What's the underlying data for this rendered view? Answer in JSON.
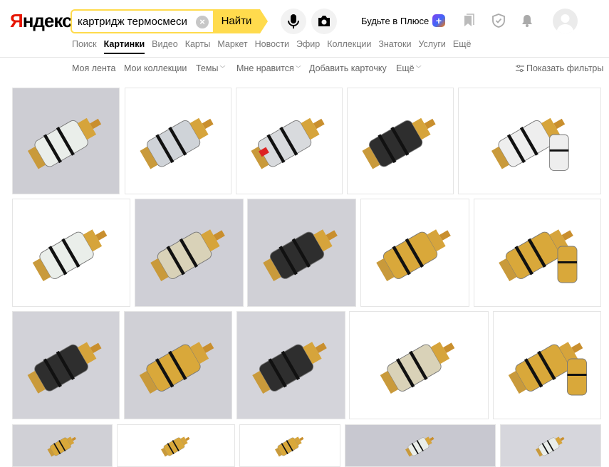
{
  "logo": {
    "first_letter": "Я",
    "rest": "ндекс"
  },
  "search": {
    "value": "картридж термосмеси",
    "button_label": "Найти"
  },
  "header": {
    "plus_label": "Будьте в Плюсе",
    "plus_badge": "+"
  },
  "services": [
    {
      "label": "Поиск"
    },
    {
      "label": "Картинки",
      "active": true
    },
    {
      "label": "Видео"
    },
    {
      "label": "Карты"
    },
    {
      "label": "Маркет"
    },
    {
      "label": "Новости"
    },
    {
      "label": "Эфир"
    },
    {
      "label": "Коллекции"
    },
    {
      "label": "Знатоки"
    },
    {
      "label": "Услуги"
    },
    {
      "label": "Ещё"
    }
  ],
  "subnav": {
    "feed": "Моя лента",
    "collections": "Мои коллекции",
    "themes": "Темы",
    "liked": "Мне нравится",
    "add_card": "Добавить карточку",
    "more": "Ещё",
    "filters": "Показать фильтры"
  },
  "images": [
    {
      "bg": "#cdcdd3",
      "style": "white"
    },
    {
      "bg": "#ffffff",
      "style": "chrome"
    },
    {
      "bg": "#ffffff",
      "style": "chrome-red"
    },
    {
      "bg": "#ffffff",
      "style": "dark"
    },
    {
      "bg": "#ffffff",
      "style": "white-duo"
    },
    {
      "bg": "#ffffff",
      "style": "white"
    },
    {
      "bg": "#cfcfd6",
      "style": "clear"
    },
    {
      "bg": "#d0d0d6",
      "style": "dark"
    },
    {
      "bg": "#ffffff",
      "style": "brass"
    },
    {
      "bg": "#ffffff",
      "style": "brass-duo"
    },
    {
      "bg": "#d2d2d8",
      "style": "dark"
    },
    {
      "bg": "#d0d0d6",
      "style": "brass"
    },
    {
      "bg": "#d4d4da",
      "style": "dark"
    },
    {
      "bg": "#ffffff",
      "style": "clear"
    },
    {
      "bg": "#ffffff",
      "style": "brass-duo"
    },
    {
      "bg": "#d0d0d6",
      "style": "brass"
    },
    {
      "bg": "#ffffff",
      "style": "brass"
    },
    {
      "bg": "#ffffff",
      "style": "brass"
    },
    {
      "bg": "#c8c8d0",
      "style": "white"
    },
    {
      "bg": "#d6d6dc",
      "style": "white"
    }
  ],
  "colors": {
    "accent_yellow": "#ffdb4d",
    "logo_red": "#e61400",
    "muted_text": "#777777"
  }
}
